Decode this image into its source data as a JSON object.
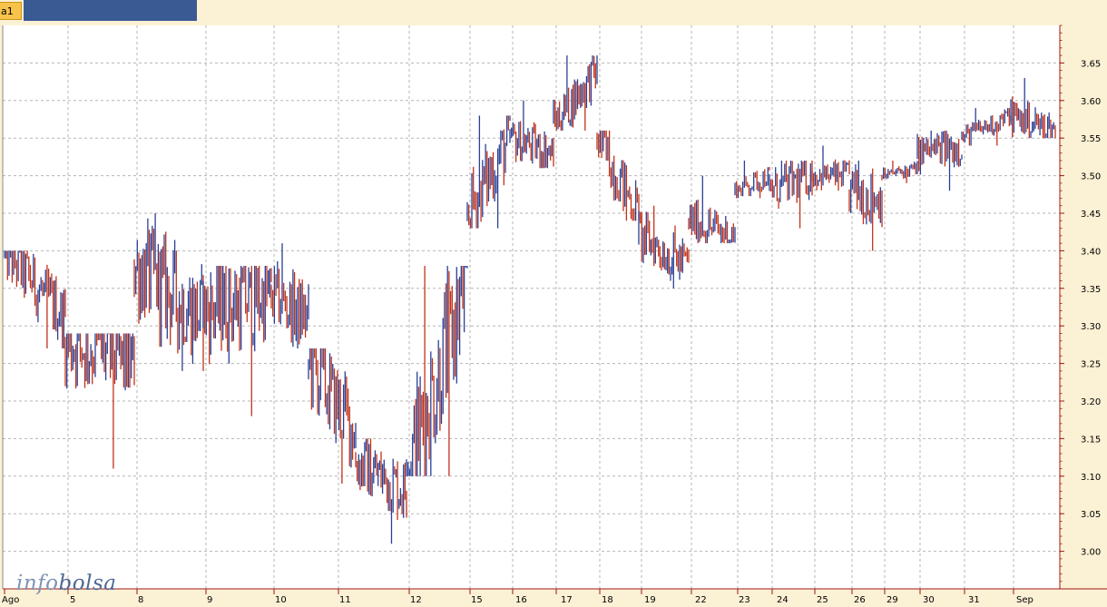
{
  "window": {
    "tab_label": "a1"
  },
  "logo": {
    "part1": "info",
    "part2": "bolsa"
  },
  "colors": {
    "tab_strip": "#3a5a94",
    "tab": "#f7c34a",
    "plot_bg": "#ffffff",
    "frame_bg": "#fbf1d4",
    "axis": "#a01818",
    "grid": "#b5b5b5",
    "up": "#2a3f96",
    "down": "#c0321a"
  },
  "chart_data": {
    "type": "ohlc",
    "title": "",
    "xlabel": "",
    "ylabel": "",
    "ylim": [
      2.95,
      3.7
    ],
    "grid": true,
    "y_ticks": [
      "3.00",
      "3.05",
      "3.10",
      "3.15",
      "3.20",
      "3.25",
      "3.30",
      "3.35",
      "3.40",
      "3.45",
      "3.50",
      "3.55",
      "3.60",
      "3.65"
    ],
    "x_ticks": [
      "Ago",
      "5",
      "8",
      "9",
      "10",
      "11",
      "12",
      "15",
      "16",
      "17",
      "18",
      "19",
      "22",
      "23",
      "24",
      "25",
      "26",
      "29",
      "30",
      "31",
      "Sep"
    ],
    "sessions": [
      {
        "day": "Ago",
        "open": 3.4,
        "high": 3.4,
        "low": 3.27,
        "close": 3.31
      },
      {
        "day": "5",
        "open": 3.28,
        "high": 3.29,
        "low": 3.11,
        "close": 3.25
      },
      {
        "day": "8",
        "open": 3.38,
        "high": 3.45,
        "low": 3.24,
        "close": 3.31
      },
      {
        "day": "9",
        "open": 3.32,
        "high": 3.38,
        "low": 3.18,
        "close": 3.34
      },
      {
        "day": "10",
        "open": 3.34,
        "high": 3.41,
        "low": 3.27,
        "close": 3.31
      },
      {
        "day": "11",
        "open": 3.25,
        "high": 3.27,
        "low": 3.09,
        "close": 3.16
      },
      {
        "day": "11b",
        "open": 3.12,
        "high": 3.15,
        "low": 3.01,
        "close": 3.08
      },
      {
        "day": "12",
        "open": 3.1,
        "high": 3.38,
        "low": 3.1,
        "close": 3.36
      },
      {
        "day": "15",
        "open": 3.45,
        "high": 3.58,
        "low": 3.43,
        "close": 3.55
      },
      {
        "day": "16",
        "open": 3.55,
        "high": 3.6,
        "low": 3.51,
        "close": 3.53
      },
      {
        "day": "17",
        "open": 3.57,
        "high": 3.66,
        "low": 3.56,
        "close": 3.64
      },
      {
        "day": "18",
        "open": 3.55,
        "high": 3.56,
        "low": 3.44,
        "close": 3.45
      },
      {
        "day": "19",
        "open": 3.42,
        "high": 3.46,
        "low": 3.35,
        "close": 3.38
      },
      {
        "day": "22",
        "open": 3.44,
        "high": 3.5,
        "low": 3.41,
        "close": 3.42
      },
      {
        "day": "23",
        "open": 3.48,
        "high": 3.52,
        "low": 3.47,
        "close": 3.5
      },
      {
        "day": "24",
        "open": 3.48,
        "high": 3.52,
        "low": 3.43,
        "close": 3.5
      },
      {
        "day": "25",
        "open": 3.5,
        "high": 3.54,
        "low": 3.48,
        "close": 3.5
      },
      {
        "day": "26",
        "open": 3.48,
        "high": 3.52,
        "low": 3.4,
        "close": 3.47
      },
      {
        "day": "29",
        "open": 3.5,
        "high": 3.52,
        "low": 3.49,
        "close": 3.51
      },
      {
        "day": "30",
        "open": 3.53,
        "high": 3.56,
        "low": 3.48,
        "close": 3.54
      },
      {
        "day": "31",
        "open": 3.55,
        "high": 3.59,
        "low": 3.54,
        "close": 3.58
      },
      {
        "day": "Sep",
        "open": 3.58,
        "high": 3.63,
        "low": 3.55,
        "close": 3.56
      }
    ]
  }
}
